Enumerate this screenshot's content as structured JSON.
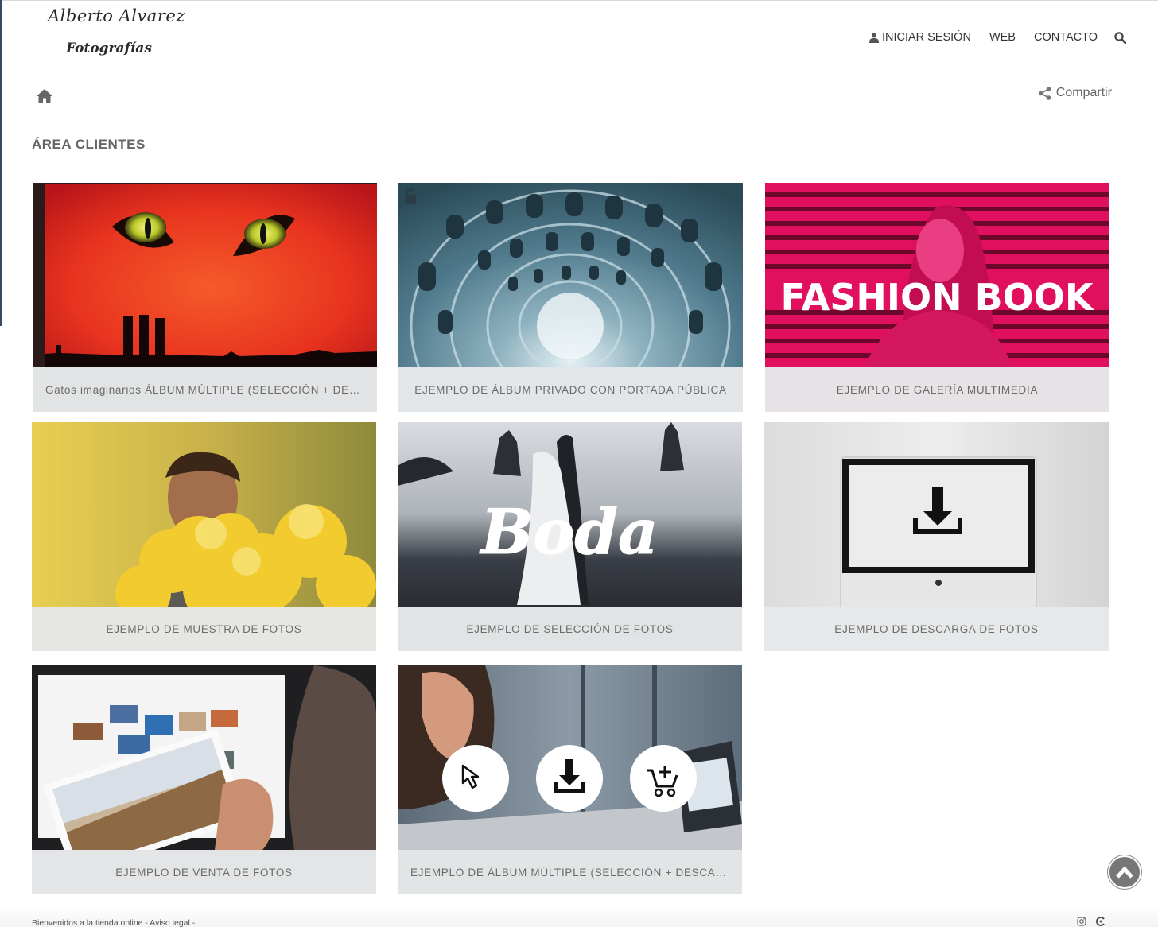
{
  "header": {
    "logo_line1": "Alberto Alvarez",
    "logo_line2": "Fotografías",
    "nav": {
      "login_label": "INICIAR SESIÓN",
      "web_label": "WEB",
      "contact_label": "CONTACTO"
    }
  },
  "toolbar": {
    "share_label": "Compartir"
  },
  "section_title": "ÁREA CLIENTES",
  "cards": [
    {
      "caption": "Gatos imaginarios ÁLBUM MÚLTIPLE (SELECCIÓN + DESCA...",
      "locked": false
    },
    {
      "caption": "EJEMPLO DE ÁLBUM PRIVADO CON PORTADA PÚBLICA",
      "locked": true
    },
    {
      "caption": "EJEMPLO DE GALERÍA MULTIMEDIA",
      "overlay_text": "FASHION BOOK",
      "locked": false
    },
    {
      "caption": "EJEMPLO DE MUESTRA DE FOTOS",
      "locked": false
    },
    {
      "caption": "EJEMPLO DE SELECCIÓN DE FOTOS",
      "overlay_text": "Boda",
      "locked": false
    },
    {
      "caption": "EJEMPLO DE DESCARGA DE FOTOS",
      "locked": false
    },
    {
      "caption": "EJEMPLO DE VENTA DE FOTOS",
      "locked": false
    },
    {
      "caption": "EJEMPLO DE ÁLBUM MÚLTIPLE (SELECCIÓN + DESCARGA ...",
      "locked": false
    }
  ],
  "footer": {
    "text": "Bienvenidos a la tienda online - Aviso legal -"
  },
  "colors": {
    "fashion_pink": "#e0105f",
    "cat_red": "#e8341f",
    "caption_bg": "#e4e6e8"
  },
  "icons": [
    "user-icon",
    "search-icon",
    "home-icon",
    "share-icon",
    "lock-icon",
    "download-icon",
    "cursor-icon",
    "cart-icon",
    "chevron-up-icon",
    "instagram-icon",
    "c-logo-icon"
  ]
}
